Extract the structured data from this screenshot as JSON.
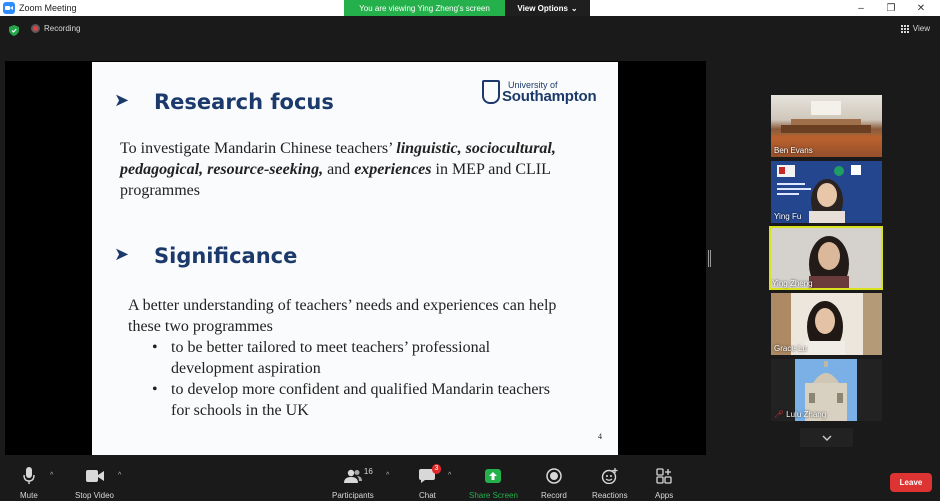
{
  "titlebar": {
    "title": "Zoom Meeting",
    "banner_text": "You are viewing Ying Zheng's screen",
    "view_options": "View Options",
    "controls": [
      "–",
      "❐",
      "✕"
    ]
  },
  "topbar": {
    "recording_label": "Recording",
    "view_label": "View"
  },
  "slide": {
    "heading1": "Research focus",
    "para1_prefix": "To investigate Mandarin Chinese teachers’ ",
    "para1_terms": [
      "linguistic,",
      "sociocultural, pedagogical, resource-seeking,"
    ],
    "para1_and": " and ",
    "para1_term_last": "experiences",
    "para1_suffix": " in MEP and CLIL programmes",
    "heading2": "Significance",
    "para2": "A better understanding of teachers’ needs and experiences can help these two programmes",
    "bullets": [
      "to be better tailored to meet teachers’ professional development aspiration",
      "to develop more confident and qualified Mandarin teachers for schools in the UK"
    ],
    "page_number": "4",
    "logo_line1": "University of",
    "logo_line2": "Southampton"
  },
  "participants_panel": [
    {
      "name": "Ben Evans",
      "active": false
    },
    {
      "name": "Ying Fu",
      "active": false
    },
    {
      "name": "Ying Zheng",
      "active": true
    },
    {
      "name": "Grace Lu",
      "active": false
    },
    {
      "name": "Lulu  Zhang",
      "active": false,
      "muted": true
    }
  ],
  "toolbar": {
    "mute": "Mute",
    "stop_video": "Stop Video",
    "participants": "Participants",
    "participants_count": "16",
    "chat": "Chat",
    "chat_badge": "3",
    "share_screen": "Share Screen",
    "record": "Record",
    "reactions": "Reactions",
    "apps": "Apps",
    "leave": "Leave"
  },
  "colors": {
    "accent_green": "#24b04b",
    "leave_red": "#dd3333",
    "active_speaker": "#d9e21f",
    "slide_heading": "#1b3a6b"
  }
}
